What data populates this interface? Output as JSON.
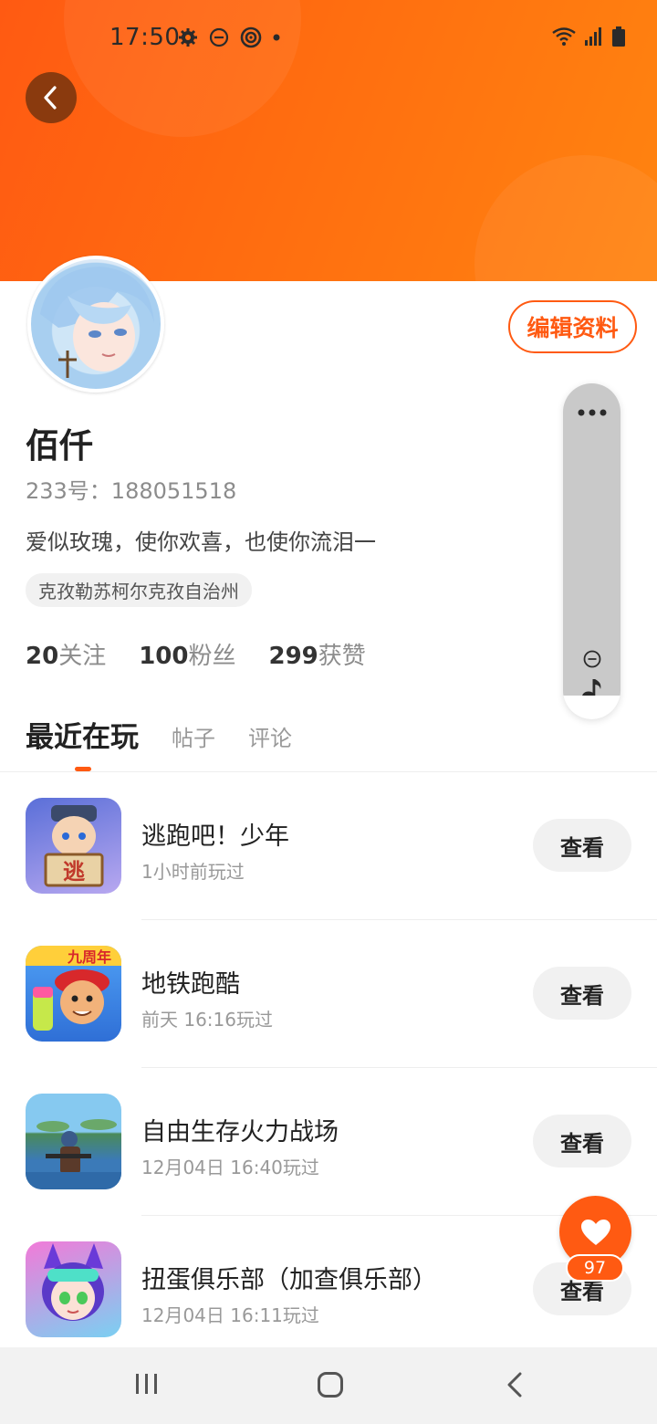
{
  "status_bar": {
    "time": "17:50"
  },
  "profile": {
    "edit_button": "编辑资料",
    "name": "佰仟",
    "account_id": "233号：188051518",
    "bio": "爱似玫瑰，使你欢喜，也使你流泪一",
    "location": "克孜勒苏柯尔克孜自治州"
  },
  "stats": [
    {
      "value": "20",
      "label": "关注"
    },
    {
      "value": "100",
      "label": "粉丝"
    },
    {
      "value": "299",
      "label": "获赞"
    }
  ],
  "tabs": [
    {
      "label": "最近在玩",
      "active": true
    },
    {
      "label": "帖子",
      "active": false
    },
    {
      "label": "评论",
      "active": false
    }
  ],
  "games": [
    {
      "title": "逃跑吧！少年",
      "played": "1小时前玩过",
      "button": "查看",
      "icon": "escape-game-icon",
      "icon_colors": [
        "#6a7be0",
        "#b9a6f2"
      ]
    },
    {
      "title": "地铁跑酷",
      "played": "前天 16:16玩过",
      "button": "查看",
      "icon": "subway-surfers-icon",
      "icon_colors": [
        "#3f8ef0",
        "#f2b73c"
      ]
    },
    {
      "title": "自由生存火力战场",
      "played": "12月04日 16:40玩过",
      "button": "查看",
      "icon": "survival-game-icon",
      "icon_colors": [
        "#6bb6e8",
        "#3f7fb0"
      ]
    },
    {
      "title": "扭蛋俱乐部（加查俱乐部）",
      "played": "12月04日 16:11玩过",
      "button": "查看",
      "icon": "gacha-club-icon",
      "icon_colors": [
        "#e85ed6",
        "#4cc9f0"
      ]
    }
  ],
  "like_fab": {
    "count": "97"
  },
  "colors": {
    "accent": "#ff5a12",
    "banner_start": "#ff5a12",
    "banner_end": "#ff8410"
  }
}
